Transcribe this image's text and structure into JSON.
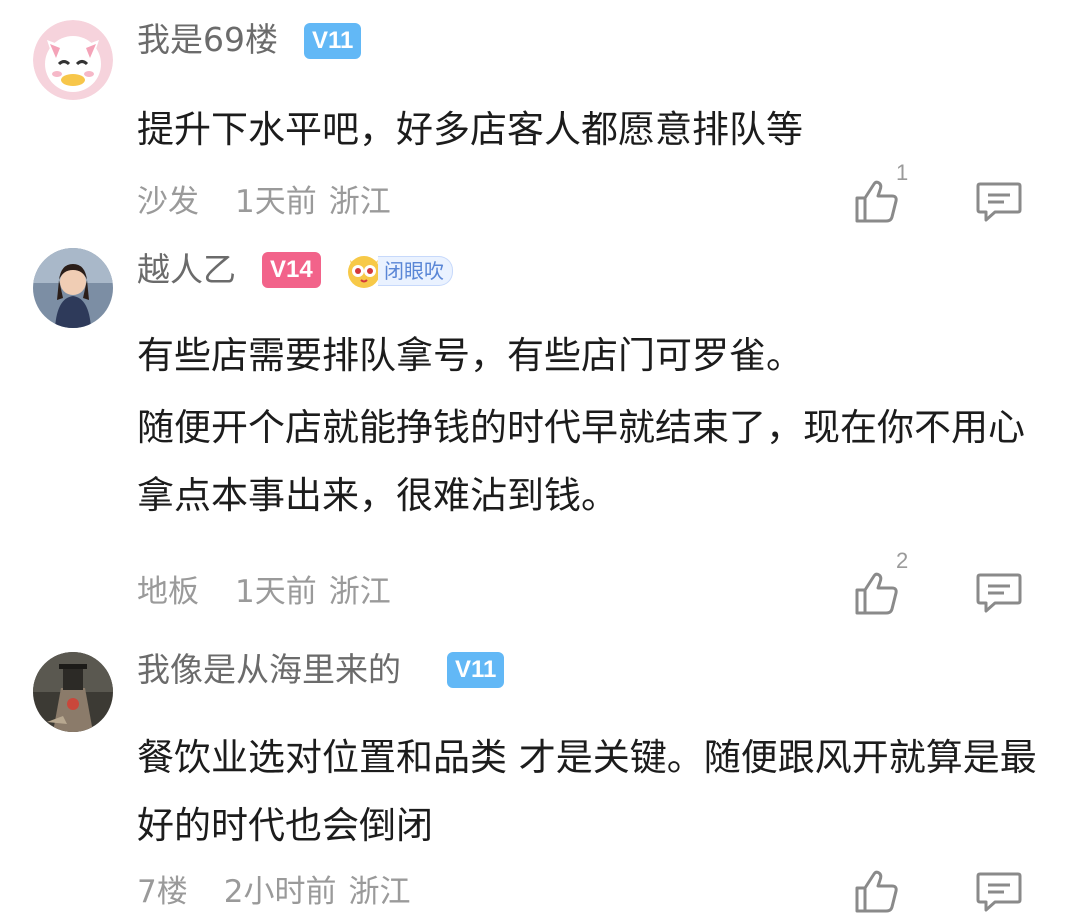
{
  "comments": [
    {
      "username": "我是69楼",
      "level": "V11",
      "level_color": "#62b8f6",
      "medal": null,
      "avatar_icon": "cartoon-cat-avatar",
      "lines": [
        "提升下水平吧，好多店客人都愿意排队等"
      ],
      "floor": "沙发",
      "time": "1天前",
      "location": "浙江",
      "likes": "1"
    },
    {
      "username": "越人乙",
      "level": "V14",
      "level_color": "#f2638a",
      "medal": "闭眼吹",
      "avatar_icon": "woman-photo-avatar",
      "lines": [
        "有些店需要排队拿号，有些店门可罗雀。",
        "随便开个店就能挣钱的时代早就结束了，现在你不用心拿点本事出来，很难沾到钱。"
      ],
      "floor": "地板",
      "time": "1天前",
      "location": "浙江",
      "likes": "2"
    },
    {
      "username": "我像是从海里来的",
      "level": "V11",
      "level_color": "#62b8f6",
      "medal": null,
      "avatar_icon": "dark-photo-avatar",
      "lines": [
        "餐饮业选对位置和品类 才是关键。随便跟风开就算是最好的时代也会倒闭"
      ],
      "floor": "7楼",
      "time": "2小时前",
      "location": "浙江",
      "likes": ""
    }
  ],
  "icons": {
    "like": "thumbs-up-icon",
    "reply": "comment-bubble-icon"
  }
}
